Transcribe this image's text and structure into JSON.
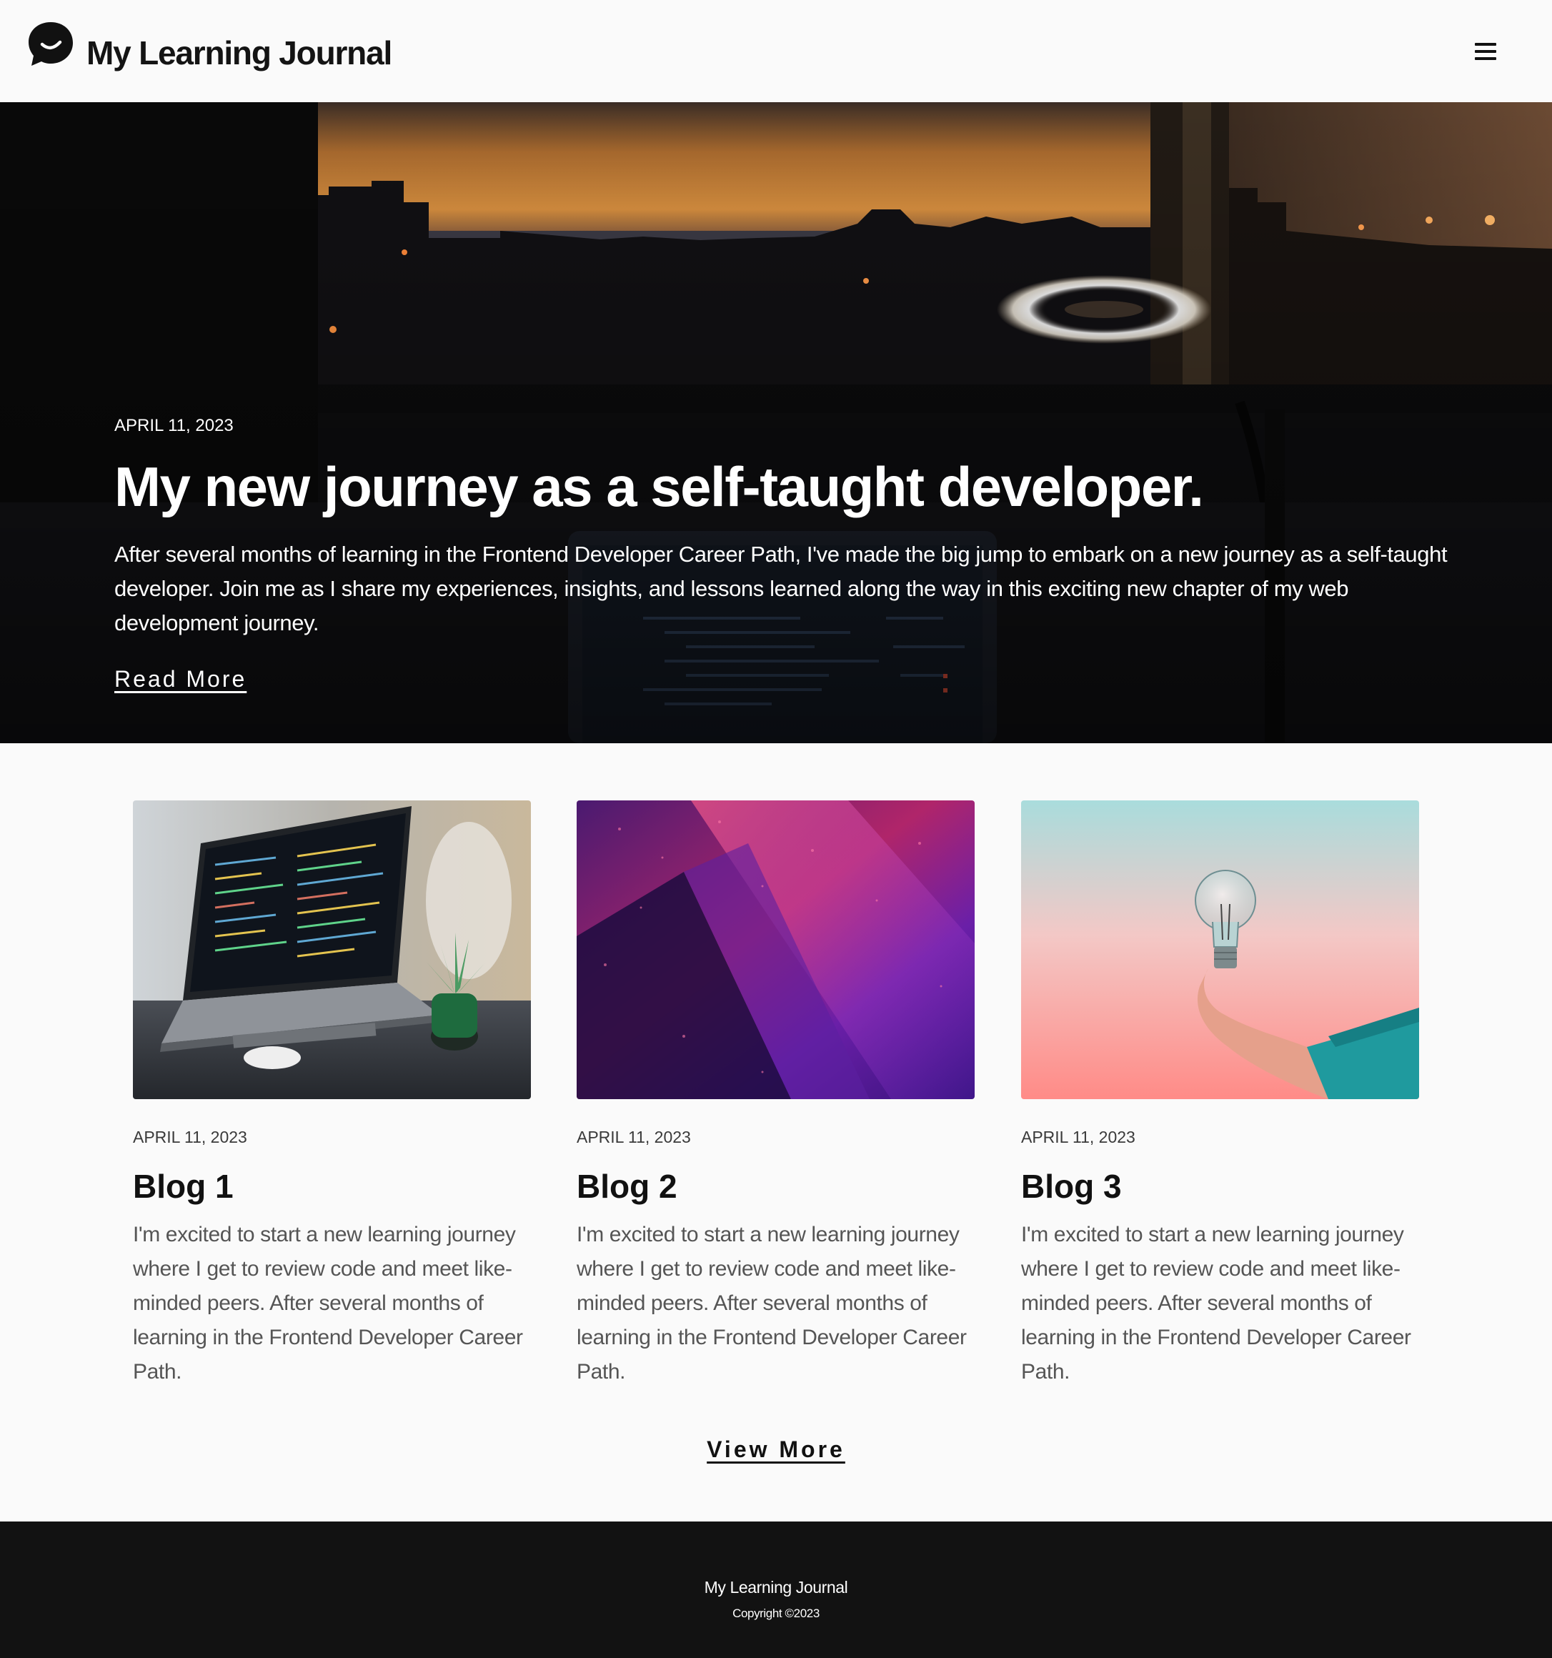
{
  "header": {
    "title": "My Learning Journal",
    "logo_icon": "chat-bubble-smile-icon",
    "menu_icon": "hamburger-menu-icon"
  },
  "hero": {
    "date": "APRIL 11, 2023",
    "title": "My new journey as a self-taught developer.",
    "text": "After several months of learning in the Frontend Developer Career Path, I've made the big jump to embark on a new journey as a self-taught developer. Join me as I share my experiences, insights, and lessons learned along the way in this exciting new chapter of my web development journey.",
    "link_label": "Read More"
  },
  "posts": [
    {
      "date": "APRIL 11, 2023",
      "title": "Blog 1",
      "text": "I'm excited to start a new learning journey where I get to review code and meet like-minded peers. After several months of learning in the Frontend Developer Career Path."
    },
    {
      "date": "APRIL 11, 2023",
      "title": "Blog 2",
      "text": "I'm excited to start a new learning journey where I get to review code and meet like-minded peers. After several months of learning in the Frontend Developer Career Path."
    },
    {
      "date": "APRIL 11, 2023",
      "title": "Blog 3",
      "text": "I'm excited to start a new learning journey where I get to review code and meet like-minded peers. After several months of learning in the Frontend Developer Career Path."
    }
  ],
  "view_more_label": "View More",
  "footer": {
    "title": "My Learning Journal",
    "copyright": "Copyright ©2023"
  },
  "colors": {
    "background": "#fafafa",
    "text": "#111111",
    "footer_background": "#121212"
  }
}
